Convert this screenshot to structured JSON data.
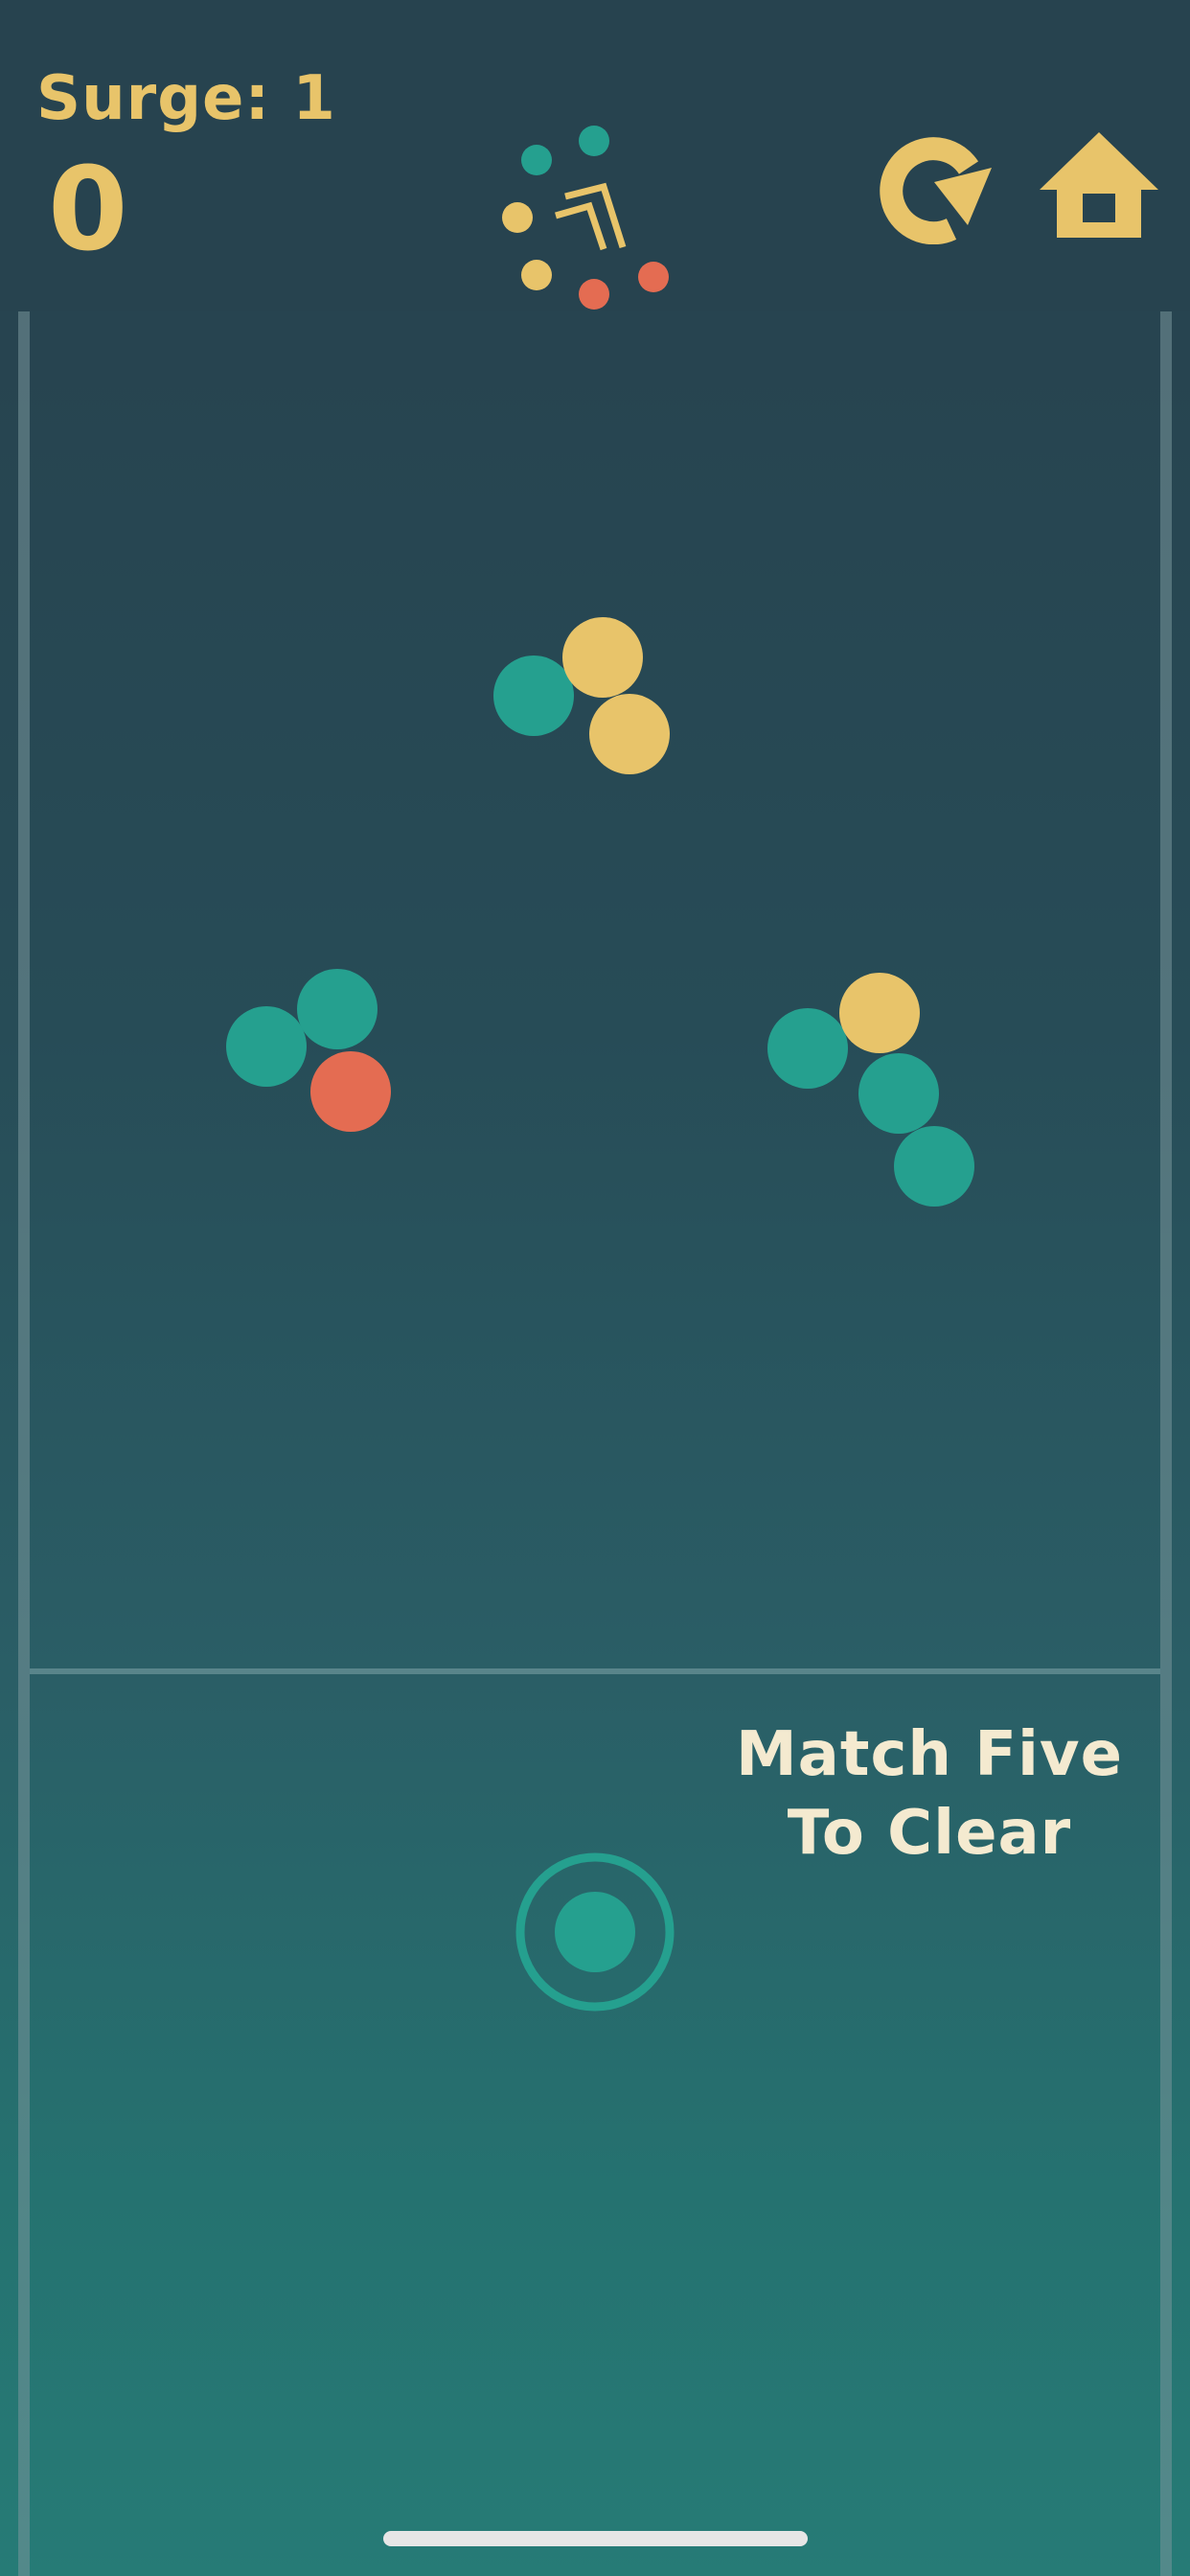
{
  "header": {
    "surge_label": "Surge: 1",
    "score": "0"
  },
  "hint": {
    "line1": "Match Five",
    "line2": "To Clear"
  },
  "icons": {
    "restart": "restart-icon",
    "home": "home-icon",
    "logo": "game-logo-icon"
  },
  "colors": {
    "background": "#27434f",
    "accent_yellow": "#e8c46a",
    "teal": "#25a08f",
    "coral": "#e46c52",
    "hint_text": "#f4ead0"
  },
  "launcher": {
    "loaded_ball_color": "teal"
  },
  "clusters": [
    {
      "name": "top-cluster",
      "balls": [
        "teal",
        "yellow",
        "yellow"
      ]
    },
    {
      "name": "left-cluster",
      "balls": [
        "teal",
        "teal",
        "coral"
      ]
    },
    {
      "name": "right-cluster",
      "balls": [
        "teal",
        "yellow",
        "teal",
        "teal"
      ]
    }
  ]
}
